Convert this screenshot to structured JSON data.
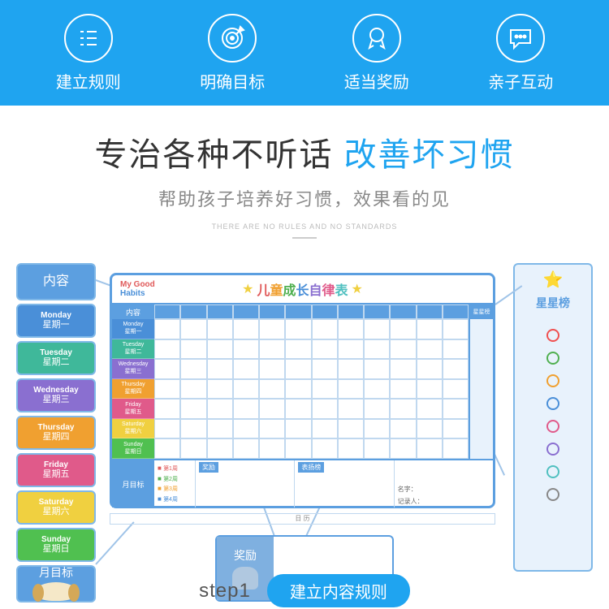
{
  "topbar": {
    "items": [
      {
        "label": "建立规则"
      },
      {
        "label": "明确目标"
      },
      {
        "label": "适当奖励"
      },
      {
        "label": "亲子互动"
      }
    ]
  },
  "headline": {
    "part1": "专治各种不听话",
    "part2": "改善坏习惯",
    "sub": "帮助孩子培养好习惯，效果看的见",
    "tiny": "THERE ARE NO RULES AND NO STANDARDS"
  },
  "left_col": {
    "header": "内容",
    "days": [
      {
        "en": "Monday",
        "zh": "星期一",
        "color": "#4a8fd8"
      },
      {
        "en": "Tuesday",
        "zh": "星期二",
        "color": "#3fb89a"
      },
      {
        "en": "Wednesday",
        "zh": "星期三",
        "color": "#8a6fd0"
      },
      {
        "en": "Thursday",
        "zh": "星期四",
        "color": "#f0a030"
      },
      {
        "en": "Friday",
        "zh": "星期五",
        "color": "#e05a8a"
      },
      {
        "en": "Saturday",
        "zh": "星期六",
        "color": "#f0d040"
      },
      {
        "en": "Sunday",
        "zh": "星期日",
        "color": "#50c050"
      }
    ],
    "footer": "月目标"
  },
  "right_col": {
    "header": "星星榜",
    "dots": [
      "#f05050",
      "#50b050",
      "#f0a030",
      "#4a8fd8",
      "#e05a8a",
      "#8a6fd0",
      "#50c0c0",
      "#888"
    ]
  },
  "chart": {
    "logo1": "My Good",
    "logo2": "Habits",
    "title_chars": [
      {
        "t": "儿",
        "c": "#e05a5a"
      },
      {
        "t": "童",
        "c": "#f0a030"
      },
      {
        "t": "成",
        "c": "#50b050"
      },
      {
        "t": "长",
        "c": "#4a8fd8"
      },
      {
        "t": "自",
        "c": "#8a6fd0"
      },
      {
        "t": "律",
        "c": "#e05a8a"
      },
      {
        "t": "表",
        "c": "#50c0c0"
      }
    ],
    "content_header": "内容",
    "star_header": "星星榜",
    "month_goal": "月目标",
    "weeks": [
      "第1周",
      "第2周",
      "第3周",
      "第4周"
    ],
    "week_colors": [
      "#e05a5a",
      "#50b050",
      "#f0a030",
      "#4a8fd8"
    ],
    "reward_label": "奖励",
    "praise_label": "表扬榜",
    "name_label": "名字：",
    "recorder_label": "记录人：",
    "calendar_label": "日 历"
  },
  "reward_callout": {
    "label": "奖励"
  },
  "bottom": {
    "step": "step1",
    "pill": "建立内容规则"
  }
}
